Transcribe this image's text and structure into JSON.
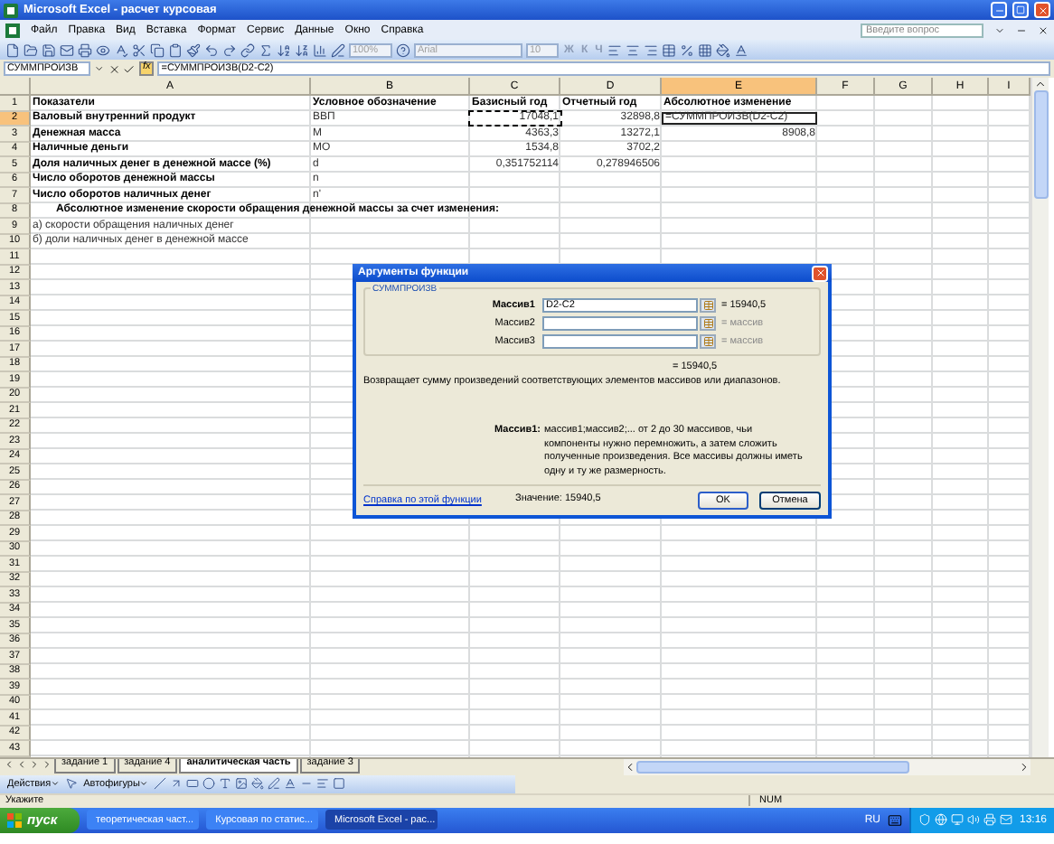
{
  "window": {
    "title": "Microsoft Excel - расчет курсовая"
  },
  "menu": [
    "Файл",
    "Правка",
    "Вид",
    "Вставка",
    "Формат",
    "Сервис",
    "Данные",
    "Окно",
    "Справка"
  ],
  "help_search": {
    "placeholder": "Введите вопрос"
  },
  "toolbar": {
    "zoom": "100%",
    "font": "Arial",
    "font_size": "10",
    "fields_disabled": true,
    "format_buttons": [
      "Ж",
      "К",
      "Ч"
    ]
  },
  "formula_bar": {
    "name_box": "СУММПРОИЗВ",
    "function_button": "fx",
    "formula": "=СУММПРОИЗВ(D2-C2)"
  },
  "columns": [
    {
      "label": "A",
      "selected": false
    },
    {
      "label": "B",
      "selected": false
    },
    {
      "label": "C",
      "selected": false
    },
    {
      "label": "D",
      "selected": false
    },
    {
      "label": "E",
      "selected": true
    },
    {
      "label": "F",
      "selected": false
    },
    {
      "label": "G",
      "selected": false
    },
    {
      "label": "H",
      "selected": false
    },
    {
      "label": "I",
      "selected": false
    }
  ],
  "rows": [
    {
      "number": "1",
      "selected": false,
      "cells": {
        "A": {
          "text": "Показатели",
          "bold": true,
          "kind": "text"
        },
        "B": {
          "text": "Условное обозначение",
          "bold": true,
          "kind": "text"
        },
        "C": {
          "text": "Базисный год",
          "bold": true,
          "kind": "text"
        },
        "D": {
          "text": "Отчетный год",
          "bold": true,
          "kind": "text"
        },
        "E": {
          "text": "Абсолютное изменение",
          "bold": true,
          "kind": "text"
        }
      }
    },
    {
      "number": "2",
      "selected": true,
      "cells": {
        "A": {
          "text": "Валовый внутренний продукт",
          "bold": true,
          "kind": "text"
        },
        "B": {
          "text": "ВВП",
          "bold": false,
          "kind": "text"
        },
        "C": {
          "text": "17048,1",
          "bold": false,
          "kind": "marquee"
        },
        "D": {
          "text": "32898,8",
          "bold": false,
          "kind": "number"
        },
        "E": {
          "text": "=СУММПРОИЗВ(D2-C2)",
          "bold": false,
          "kind": "formula"
        }
      }
    },
    {
      "number": "3",
      "selected": false,
      "cells": {
        "A": {
          "text": "Денежная масса",
          "bold": true,
          "kind": "text"
        },
        "B": {
          "text": "M",
          "bold": false,
          "kind": "text"
        },
        "C": {
          "text": "4363,3",
          "bold": false,
          "kind": "number"
        },
        "D": {
          "text": "13272,1",
          "bold": false,
          "kind": "number"
        },
        "E": {
          "text": "8908,8",
          "bold": false,
          "kind": "number"
        }
      }
    },
    {
      "number": "4",
      "selected": false,
      "cells": {
        "A": {
          "text": "Наличные деньги",
          "bold": true,
          "kind": "text"
        },
        "B": {
          "text": "MO",
          "bold": false,
          "kind": "text"
        },
        "C": {
          "text": "1534,8",
          "bold": false,
          "kind": "number"
        },
        "D": {
          "text": "3702,2",
          "bold": false,
          "kind": "number"
        }
      }
    },
    {
      "number": "5",
      "selected": false,
      "cells": {
        "A": {
          "text": "Доля наличных денег в денежной массе (%)",
          "bold": true,
          "kind": "text"
        },
        "B": {
          "text": "d",
          "bold": false,
          "kind": "text"
        },
        "C": {
          "text": "0,351752114",
          "bold": false,
          "kind": "number"
        },
        "D": {
          "text": "0,278946506",
          "bold": false,
          "kind": "number"
        }
      }
    },
    {
      "number": "6",
      "selected": false,
      "cells": {
        "A": {
          "text": "Число оборотов денежной массы",
          "bold": true,
          "kind": "text"
        },
        "B": {
          "text": "n",
          "bold": false,
          "kind": "text"
        }
      }
    },
    {
      "number": "7",
      "selected": false,
      "cells": {
        "A": {
          "text": "Число оборотов наличных денег",
          "bold": true,
          "kind": "text"
        },
        "B": {
          "text": "n'",
          "bold": false,
          "kind": "text"
        }
      }
    },
    {
      "number": "8",
      "selected": false,
      "cells": {
        "A": {
          "text": "Абсолютное изменение скорости обращения денежной массы за счет изменения:",
          "bold": true,
          "kind": "heading"
        }
      }
    },
    {
      "number": "9",
      "selected": false,
      "cells": {
        "A": {
          "text": "а) скорости обращения наличных денег",
          "bold": false,
          "kind": "text"
        }
      }
    },
    {
      "number": "10",
      "selected": false,
      "cells": {
        "A": {
          "text": "б) доли наличных денег в денежной массе",
          "bold": false,
          "kind": "text"
        }
      }
    }
  ],
  "empty_rows": [
    "11",
    "12",
    "13",
    "14",
    "15",
    "16",
    "17",
    "18",
    "19",
    "20",
    "21",
    "22",
    "23",
    "24",
    "25",
    "26",
    "27",
    "28",
    "29",
    "30",
    "31",
    "32",
    "33",
    "34",
    "35",
    "36",
    "37",
    "38",
    "39",
    "40",
    "41",
    "42",
    "43"
  ],
  "dialog": {
    "title": "Аргументы функции",
    "function": "СУММПРОИЗВ",
    "arguments": [
      {
        "label": "Массив1",
        "value": "D2-C2",
        "result": "= 15940,5",
        "active": true
      },
      {
        "label": "Массив2",
        "result": "= массив",
        "active": false
      },
      {
        "label": "Массив3",
        "result": "= массив",
        "active": false
      }
    ],
    "total": "= 15940,5",
    "description": "Возвращает сумму произведений соответствующих элементов массивов или диапазонов.",
    "argument_help_label": "Массив1:",
    "argument_help": "массив1;массив2;... от 2 до 30 массивов, чьи компоненты нужно перемножить, а затем сложить полученные произведения. Все массивы должны иметь одну и ту же размерность.",
    "help_link": "Справка по этой функции",
    "value": "Значение: 15940,5",
    "buttons": [
      "OK",
      "Отмена"
    ]
  },
  "sheet_tabs": [
    {
      "label": "задание 1",
      "selected": false
    },
    {
      "label": "задание 4",
      "selected": false
    },
    {
      "label": "аналитическая часть",
      "selected": true
    },
    {
      "label": "задание 3",
      "selected": false
    }
  ],
  "drawing_toolbar": {
    "actions": "Действия",
    "autoshapes": "Автофигуры"
  },
  "status_bar": {
    "text": "Укажите",
    "num": "NUM"
  },
  "taskbar": {
    "start": "пуск",
    "tasks": [
      {
        "label": "теоретическая част...",
        "selected": false
      },
      {
        "label": "Курсовая по статис...",
        "selected": false
      },
      {
        "label": "Microsoft Excel - рас...",
        "selected": true
      }
    ],
    "language": "RU",
    "clock": "13:16"
  }
}
